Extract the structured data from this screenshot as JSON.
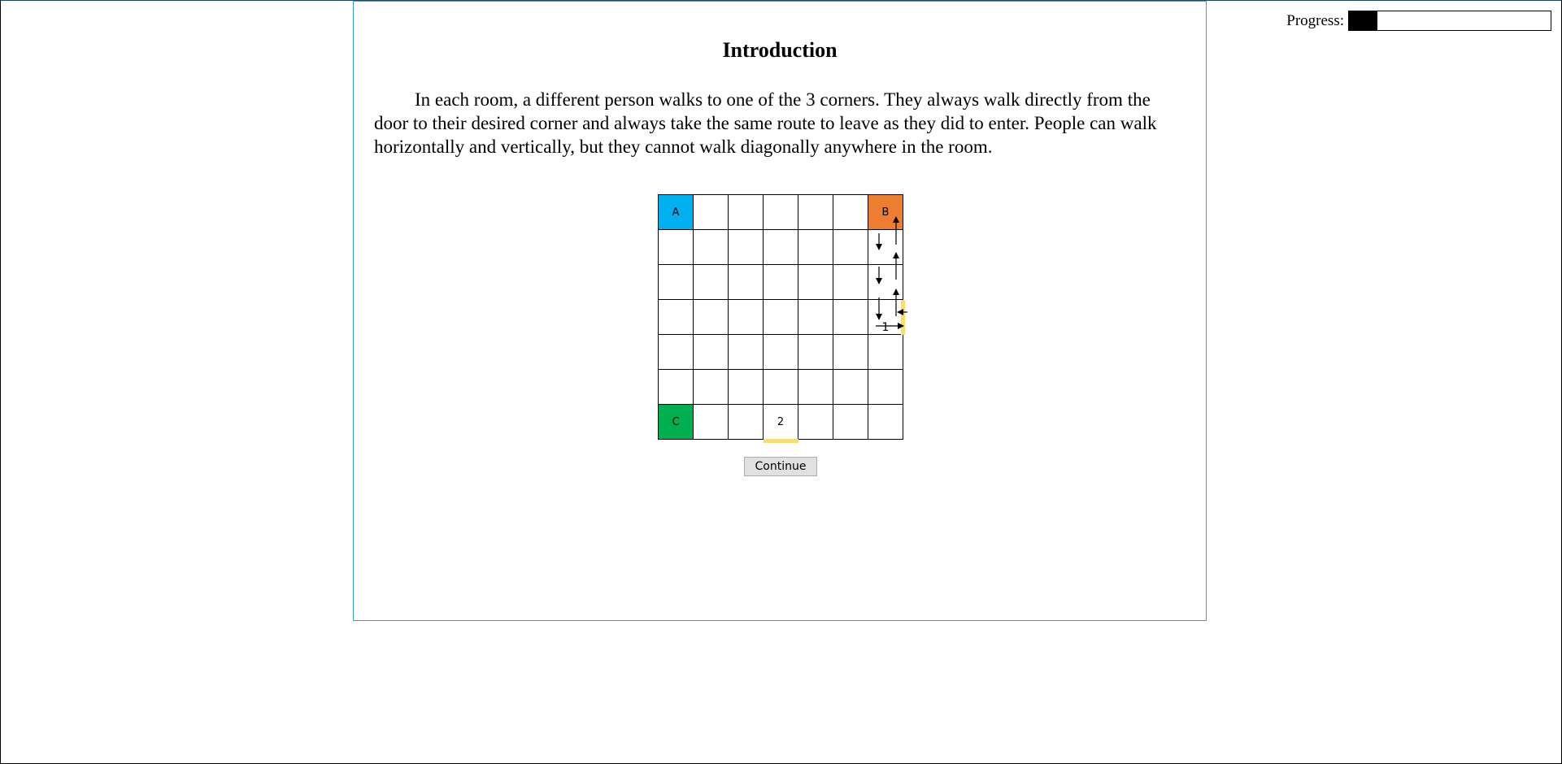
{
  "progress": {
    "label": "Progress:",
    "fraction": 0.14
  },
  "page": {
    "title": "Introduction",
    "body": "In each room, a different person walks to one of the 3 corners. They always walk directly from the door to their desired corner and always take the same route to leave as they did to enter. People can walk horizontally and vertically, but they cannot walk diagonally anywhere in the room."
  },
  "grid": {
    "rows": 7,
    "cols": 7,
    "corners": [
      {
        "label": "A",
        "row": 0,
        "col": 0,
        "color": "#00b0f0"
      },
      {
        "label": "B",
        "row": 0,
        "col": 6,
        "color": "#ed7d31"
      },
      {
        "label": "C",
        "row": 6,
        "col": 0,
        "color": "#00b050"
      }
    ],
    "doors": [
      {
        "label": "1",
        "row": 3,
        "col": 6,
        "side": "right"
      },
      {
        "label": "2",
        "row": 6,
        "col": 3,
        "side": "bottom"
      }
    ],
    "door_color": "#f7dd72"
  },
  "buttons": {
    "continue_label": "Continue"
  }
}
